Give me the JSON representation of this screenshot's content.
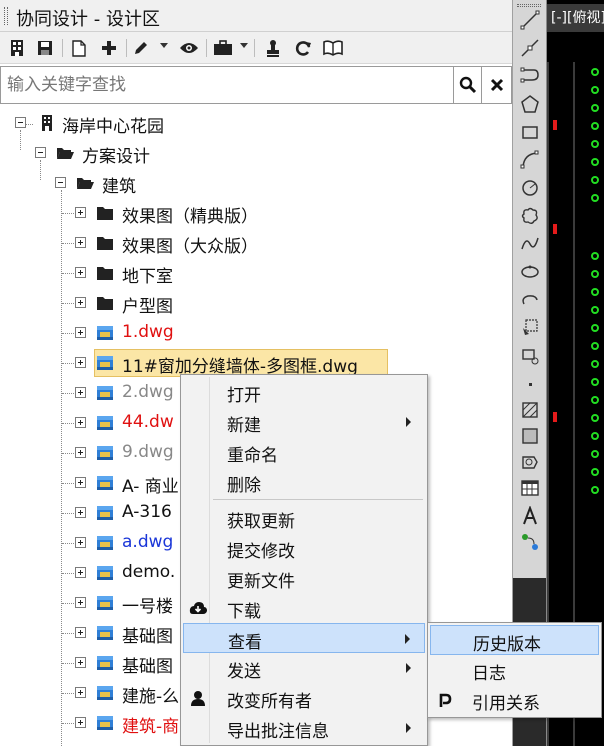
{
  "panel": {
    "title": "协同设计 - 设计区",
    "search": {
      "placeholder": "输入关键字查找"
    }
  },
  "tree": {
    "root": "海岸中心花园",
    "l1": "方案设计",
    "l2": "建筑",
    "items": [
      {
        "label": "效果图（精典版）",
        "kind": "folder"
      },
      {
        "label": "效果图（大众版）",
        "kind": "folder"
      },
      {
        "label": "地下室",
        "kind": "folder"
      },
      {
        "label": "户型图",
        "kind": "folder"
      },
      {
        "label": "1.dwg",
        "kind": "dwg",
        "color": "red"
      },
      {
        "label": "11#窗加分缝墙体-多图框.dwg",
        "kind": "dwg",
        "color": "normal",
        "selected": true
      },
      {
        "label": "2.dwg",
        "kind": "dwg",
        "color": "gray"
      },
      {
        "label": "44.dw",
        "kind": "dwg",
        "color": "red"
      },
      {
        "label": "9.dwg",
        "kind": "dwg",
        "color": "gray"
      },
      {
        "label": "A- 商业",
        "kind": "dwg",
        "color": "normal"
      },
      {
        "label": "A-316",
        "kind": "dwg",
        "color": "normal"
      },
      {
        "label": "a.dwg",
        "kind": "dwg",
        "color": "blue"
      },
      {
        "label": "demo.",
        "kind": "dwg",
        "color": "normal"
      },
      {
        "label": "一号楼",
        "kind": "dwg",
        "color": "normal"
      },
      {
        "label": "基础图",
        "kind": "dwg",
        "color": "normal"
      },
      {
        "label": "基础图",
        "kind": "dwg",
        "color": "normal"
      },
      {
        "label": "建施-么",
        "kind": "dwg",
        "color": "normal"
      },
      {
        "label": "建筑-商",
        "kind": "dwg",
        "color": "red"
      }
    ]
  },
  "context_menu": {
    "items": [
      {
        "label": "打开",
        "submenu": false
      },
      {
        "label": "新建",
        "submenu": true
      },
      {
        "label": "重命名",
        "submenu": false
      },
      {
        "label": "删除",
        "submenu": false
      },
      {
        "label": "获取更新",
        "submenu": false
      },
      {
        "label": "提交修改",
        "submenu": false
      },
      {
        "label": "更新文件",
        "submenu": false
      },
      {
        "label": "下载",
        "submenu": false,
        "icon": "cloud-download-icon"
      },
      {
        "label": "查看",
        "submenu": true,
        "highlighted": true
      },
      {
        "label": "发送",
        "submenu": true
      },
      {
        "label": "改变所有者",
        "submenu": false,
        "icon": "user-icon"
      },
      {
        "label": "导出批注信息",
        "submenu": true
      }
    ]
  },
  "submenu": {
    "items": [
      {
        "label": "历史版本",
        "highlighted": true
      },
      {
        "label": "日志"
      },
      {
        "label": "引用关系",
        "icon": "reference-icon"
      }
    ]
  },
  "cad": {
    "tab_label": "[-][俯视]"
  },
  "colors": {
    "selected": "#fbe6a6",
    "menu_highlight": "#cde2fb",
    "red_text": "#e01010",
    "blue_text": "#1a36d8",
    "cad_bg": "#000000",
    "cad_marker": "#22dd22"
  }
}
